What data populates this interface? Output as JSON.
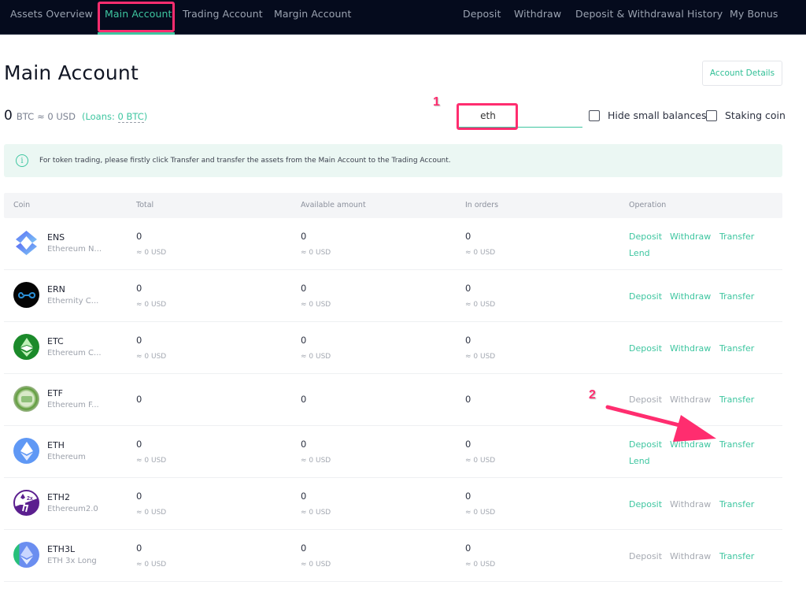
{
  "nav": {
    "left": [
      {
        "label": "Assets Overview",
        "active": false
      },
      {
        "label": "Main Account",
        "active": true
      },
      {
        "label": "Trading Account",
        "active": false
      },
      {
        "label": "Margin Account",
        "active": false
      }
    ],
    "right": [
      {
        "label": "Deposit"
      },
      {
        "label": "Withdraw"
      },
      {
        "label": "Deposit & Withdrawal History"
      },
      {
        "label": "My Bonus"
      }
    ]
  },
  "page": {
    "title": "Main Account",
    "account_details_label": "Account Details"
  },
  "balance": {
    "amount": "0",
    "unit": "BTC",
    "usd": "≈ 0 USD",
    "loans_prefix": "(Loans: ",
    "loans_value": "0 BTC",
    "loans_suffix": ")"
  },
  "filters": {
    "search_value": "eth",
    "hide_small_label": "Hide small balances",
    "hide_small_checked": false,
    "staking_label": "Staking coin",
    "staking_checked": false
  },
  "annotations": {
    "marker1": "1",
    "marker2": "2",
    "highlight_color": "#ff2d6f"
  },
  "notice": {
    "icon": "info-icon",
    "text": "For token trading, please firstly click Transfer and transfer the assets from the Main Account to the Trading Account."
  },
  "table": {
    "headers": [
      "Coin",
      "Total",
      "Available amount",
      "In orders",
      "Operation"
    ],
    "rows": [
      {
        "symbol": "ENS",
        "name": "Ethereum N...",
        "total": "0",
        "total_usd": "≈ 0 USD",
        "available": "0",
        "available_usd": "≈ 0 USD",
        "in_orders": "0",
        "in_orders_usd": "≈ 0 USD",
        "ops": [
          {
            "label": "Deposit",
            "enabled": true
          },
          {
            "label": "Withdraw",
            "enabled": true
          },
          {
            "label": "Transfer",
            "enabled": true
          },
          {
            "label": "Lend",
            "enabled": true
          }
        ]
      },
      {
        "symbol": "ERN",
        "name": "Ethernity C...",
        "total": "0",
        "total_usd": "≈ 0 USD",
        "available": "0",
        "available_usd": "≈ 0 USD",
        "in_orders": "0",
        "in_orders_usd": "≈ 0 USD",
        "ops": [
          {
            "label": "Deposit",
            "enabled": true
          },
          {
            "label": "Withdraw",
            "enabled": true
          },
          {
            "label": "Transfer",
            "enabled": true
          }
        ]
      },
      {
        "symbol": "ETC",
        "name": "Ethereum C...",
        "total": "0",
        "total_usd": "≈ 0 USD",
        "available": "0",
        "available_usd": "≈ 0 USD",
        "in_orders": "0",
        "in_orders_usd": "≈ 0 USD",
        "ops": [
          {
            "label": "Deposit",
            "enabled": true
          },
          {
            "label": "Withdraw",
            "enabled": true
          },
          {
            "label": "Transfer",
            "enabled": true
          }
        ]
      },
      {
        "symbol": "ETF",
        "name": "Ethereum F...",
        "total": "0",
        "total_usd": null,
        "available": "0",
        "available_usd": null,
        "in_orders": "0",
        "in_orders_usd": null,
        "ops": [
          {
            "label": "Deposit",
            "enabled": false
          },
          {
            "label": "Withdraw",
            "enabled": false
          },
          {
            "label": "Transfer",
            "enabled": true
          }
        ]
      },
      {
        "symbol": "ETH",
        "name": "Ethereum",
        "total": "0",
        "total_usd": "≈ 0 USD",
        "available": "0",
        "available_usd": "≈ 0 USD",
        "in_orders": "0",
        "in_orders_usd": "≈ 0 USD",
        "ops": [
          {
            "label": "Deposit",
            "enabled": true
          },
          {
            "label": "Withdraw",
            "enabled": true
          },
          {
            "label": "Transfer",
            "enabled": true
          },
          {
            "label": "Lend",
            "enabled": true
          }
        ]
      },
      {
        "symbol": "ETH2",
        "name": "Ethereum2.0",
        "total": "0",
        "total_usd": "≈ 0 USD",
        "available": "0",
        "available_usd": "≈ 0 USD",
        "in_orders": "0",
        "in_orders_usd": "≈ 0 USD",
        "ops": [
          {
            "label": "Deposit",
            "enabled": true
          },
          {
            "label": "Withdraw",
            "enabled": false
          },
          {
            "label": "Transfer",
            "enabled": true
          }
        ]
      },
      {
        "symbol": "ETH3L",
        "name": "ETH 3x Long",
        "total": "0",
        "total_usd": "≈ 0 USD",
        "available": "0",
        "available_usd": "≈ 0 USD",
        "in_orders": "0",
        "in_orders_usd": "≈ 0 USD",
        "ops": [
          {
            "label": "Deposit",
            "enabled": false
          },
          {
            "label": "Withdraw",
            "enabled": false
          },
          {
            "label": "Transfer",
            "enabled": true
          }
        ]
      }
    ]
  },
  "colors": {
    "accent": "#3ec6a0",
    "nav_bg": "#050b1d",
    "disabled": "#a6aab2",
    "annotation": "#ff2d6f"
  }
}
